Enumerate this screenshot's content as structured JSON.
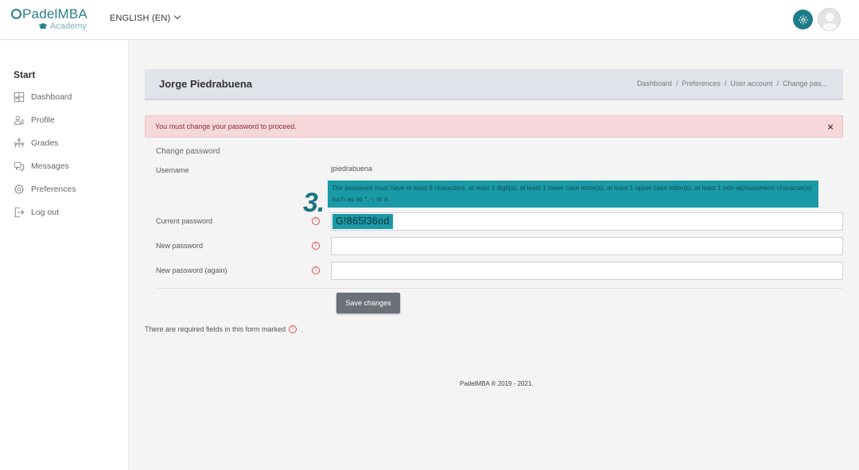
{
  "navbar": {
    "logo_main": "PadelMBA",
    "logo_sub": "Academy",
    "language": "ENGLISH (EN)"
  },
  "sidebar": {
    "title": "Start",
    "items": [
      {
        "label": "Dashboard",
        "icon": "dashboard-icon"
      },
      {
        "label": "Profile",
        "icon": "profile-icon"
      },
      {
        "label": "Grades",
        "icon": "grades-icon"
      },
      {
        "label": "Messages",
        "icon": "messages-icon"
      },
      {
        "label": "Preferences",
        "icon": "gear-icon"
      },
      {
        "label": "Log out",
        "icon": "logout-icon"
      }
    ]
  },
  "header": {
    "title": "Jorge Piedrabuena",
    "breadcrumb": [
      "Dashboard",
      "Preferences",
      "User account",
      "Change pas..."
    ]
  },
  "alert": {
    "message": "You must change your password to proceed.",
    "close": "×"
  },
  "form": {
    "section_title": "Change password",
    "username_label": "Username",
    "username_value": "jpiedrabuena",
    "password_hint": "The password must have at least 8 characters, at least 1 digit(s), at least 1 lower case letter(s), at least 1 upper case letter(s), at least 1 non-alphanumeric character(s) such as as *, -, or #",
    "step_marker": "3.",
    "current_password_label": "Current password",
    "current_password_value": "G!865l36od",
    "new_password_label": "New password",
    "new_password_value": "",
    "new_password_again_label": "New password (again)",
    "new_password_again_value": "",
    "required_mark": "!",
    "save_label": "Save changes",
    "required_note": "There are required fields in this form marked",
    "required_note_end": "."
  },
  "footer": {
    "text": "PadelMBA ® 2019 - 2021."
  },
  "colors": {
    "accent": "#1e7c8a",
    "highlight": "#1a9aa6",
    "alert_bg": "#f6d7da",
    "required": "#e04b4b"
  }
}
